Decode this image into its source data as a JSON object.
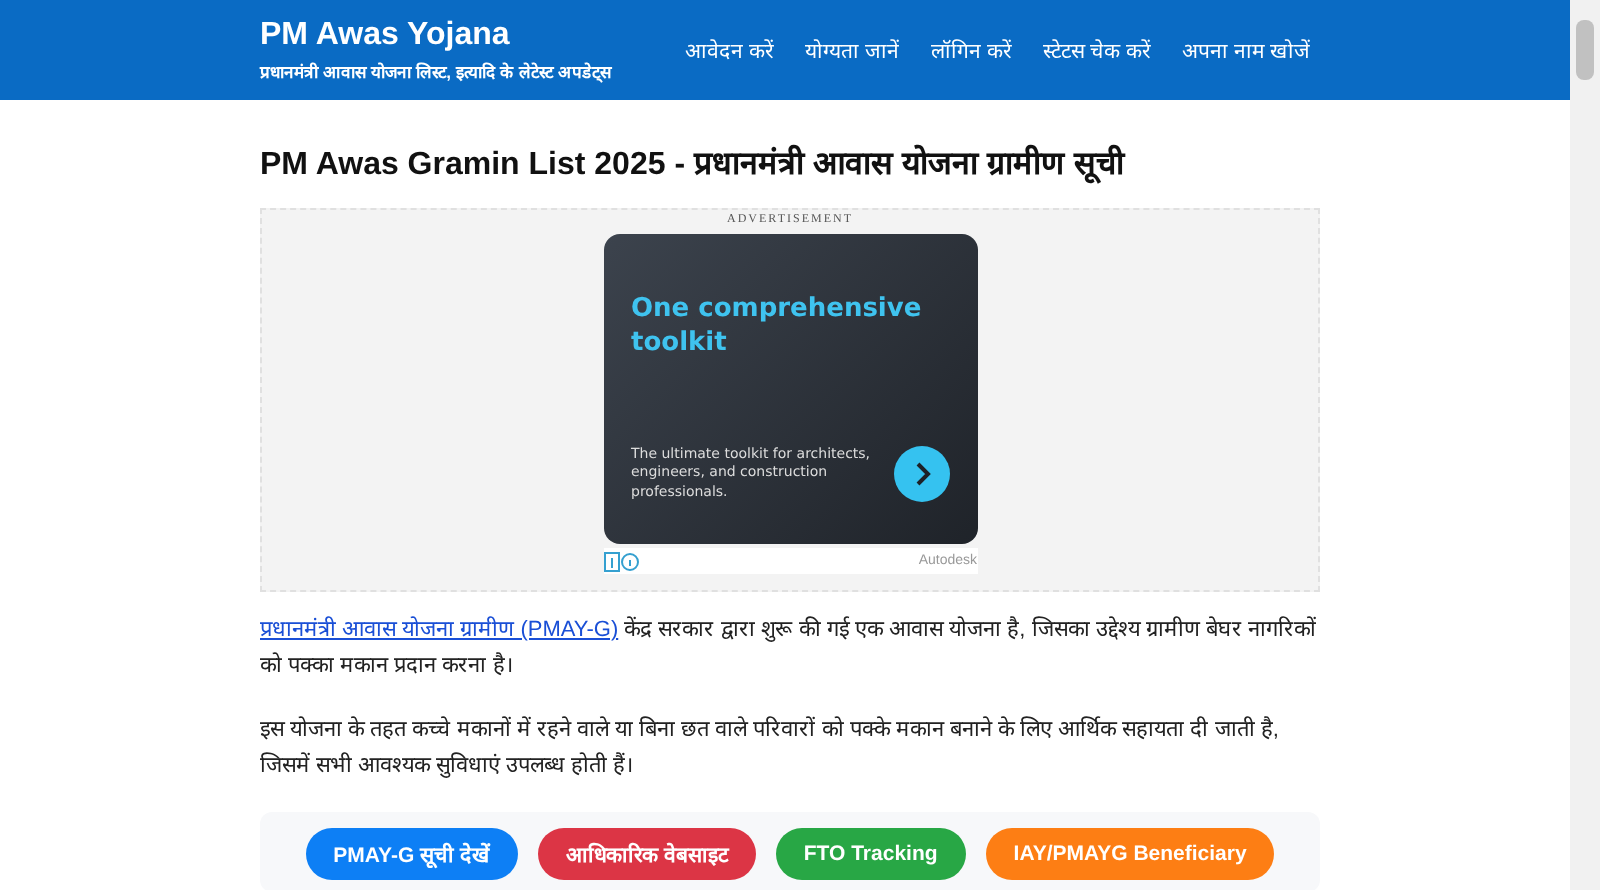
{
  "header": {
    "site_title": "PM Awas Yojana",
    "tagline": "प्रधानमंत्री आवास योजना लिस्ट, इत्यादि के लेटेस्ट अपडेट्स",
    "nav": [
      "आवेदन करें",
      "योग्यता जानें",
      "लॉगिन करें",
      "स्टेटस चेक करें",
      "अपना नाम खोजें"
    ]
  },
  "article": {
    "title": "PM Awas Gramin List 2025 - प्रधानमंत्री आवास योजना ग्रामीण सूची",
    "advertisement": {
      "label": "ADVERTISEMENT",
      "headline": "One comprehensive toolkit",
      "body": "The ultimate toolkit for architects, engineers, and construction professionals.",
      "advertiser": "Autodesk"
    },
    "intro_link": "प्रधानमंत्री आवास योजना ग्रामीण (PMAY-G)",
    "intro_rest": "केंद्र सरकार द्वारा शुरू की गई एक आवास योजना है, जिसका उद्देश्य ग्रामीण बेघर नागरिकों को पक्का मकान प्रदान करना है।",
    "paragraph": "इस योजना के तहत कच्चे मकानों में रहने वाले या बिना छत वाले परिवारों को पक्के मकान बनाने के लिए आर्थिक सहायता दी जाती है, जिसमें सभी आवश्यक सुविधाएं उपलब्ध होती हैं।",
    "buttons": [
      {
        "label": "PMAY-G सूची देखें",
        "color": "#0d7ff5"
      },
      {
        "label": "आधिकारिक वेबसाइट",
        "color": "#dc3545"
      },
      {
        "label": "FTO Tracking",
        "color": "#28a745"
      },
      {
        "label": "IAY/PMAYG Beneficiary",
        "color": "#fd7e14"
      }
    ]
  }
}
